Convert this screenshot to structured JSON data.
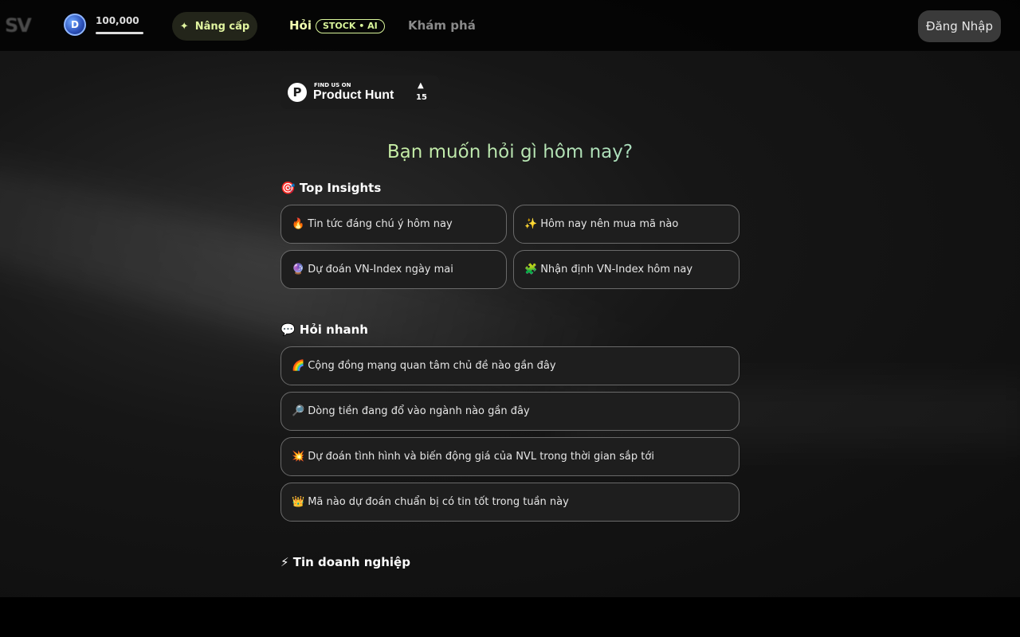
{
  "header": {
    "logo_text": "SV",
    "coin_icon": "dnse-coin-icon",
    "coin_letter": "D",
    "coin_value": "100,000",
    "upgrade_label": "Nâng cấp",
    "upgrade_icon": "sparkle-icon",
    "nav_ask": "Hỏi",
    "nav_badge": "STOCK • AI",
    "nav_explore": "Khám phá",
    "login_label": "Đăng Nhập"
  },
  "product_hunt": {
    "small_text": "FIND US ON",
    "name": "Product Hunt",
    "logo_letter": "P",
    "votes": "15"
  },
  "hero_question": "Bạn muốn hỏi gì hôm nay?",
  "sections": {
    "top_insights": {
      "emoji": "🎯",
      "title": "Top Insights",
      "items": [
        {
          "emoji": "🔥",
          "label": "Tin tức đáng chú ý hôm nay"
        },
        {
          "emoji": "✨",
          "label": "Hôm nay nên mua mã nào"
        },
        {
          "emoji": "🔮",
          "label": "Dự đoán VN-Index ngày mai"
        },
        {
          "emoji": "🧩",
          "label": "Nhận định VN-Index hôm nay"
        }
      ]
    },
    "quick_ask": {
      "emoji": "💬",
      "title": "Hỏi nhanh",
      "items": [
        {
          "emoji": "🌈",
          "label": "Cộng đồng mạng quan tâm chủ đề nào gần đây"
        },
        {
          "emoji": "🔎",
          "label": "Dòng tiền đang đổ vào ngành nào gần đây"
        },
        {
          "emoji": "💥",
          "label": " Dự đoán tình hình và biến động giá của NVL trong thời gian sắp tới"
        },
        {
          "emoji": "👑",
          "label": "Mã nào dự đoán chuẩn bị có tin tốt trong tuần này"
        }
      ]
    },
    "business_news": {
      "emoji": "⚡",
      "title": "Tin doanh nghiệp"
    }
  }
}
